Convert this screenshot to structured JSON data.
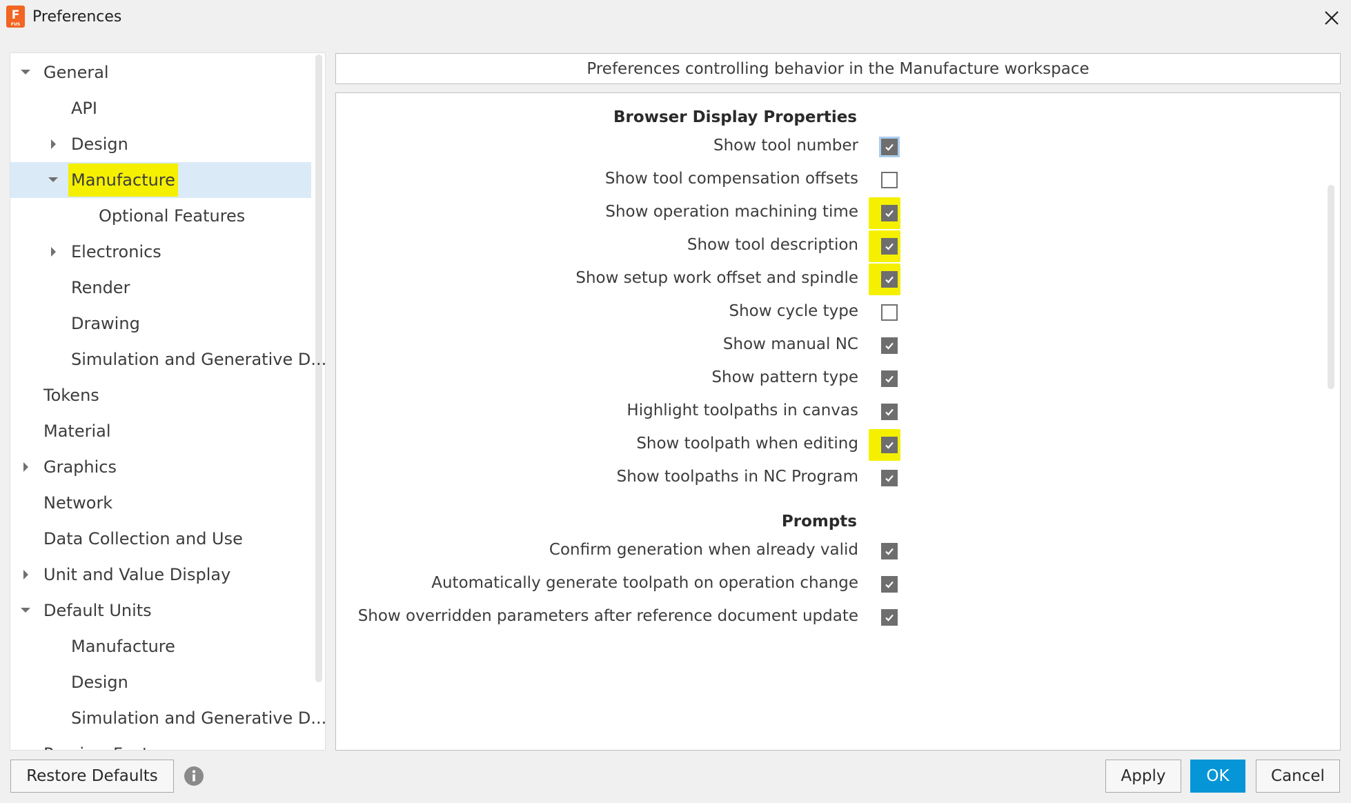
{
  "window": {
    "title": "Preferences",
    "app_icon_letter": "F",
    "app_icon_sub": "FUS"
  },
  "tree": {
    "items": [
      {
        "label": "General",
        "level": 0,
        "expander": "expanded"
      },
      {
        "label": "API",
        "level": 1,
        "expander": "none"
      },
      {
        "label": "Design",
        "level": 1,
        "expander": "collapsed"
      },
      {
        "label": "Manufacture",
        "level": 1,
        "expander": "expanded",
        "selected": true,
        "highlighted": true
      },
      {
        "label": "Optional Features",
        "level": 2,
        "expander": "none"
      },
      {
        "label": "Electronics",
        "level": 1,
        "expander": "collapsed"
      },
      {
        "label": "Render",
        "level": 1,
        "expander": "none"
      },
      {
        "label": "Drawing",
        "level": 1,
        "expander": "none"
      },
      {
        "label": "Simulation and Generative D...",
        "level": 1,
        "expander": "none"
      },
      {
        "label": "Tokens",
        "level": 0,
        "expander": "none"
      },
      {
        "label": "Material",
        "level": 0,
        "expander": "none"
      },
      {
        "label": "Graphics",
        "level": 0,
        "expander": "collapsed"
      },
      {
        "label": "Network",
        "level": 0,
        "expander": "none"
      },
      {
        "label": "Data Collection and Use",
        "level": 0,
        "expander": "none"
      },
      {
        "label": "Unit and Value Display",
        "level": 0,
        "expander": "collapsed"
      },
      {
        "label": "Default Units",
        "level": 0,
        "expander": "expanded"
      },
      {
        "label": "Manufacture",
        "level": 1,
        "expander": "none"
      },
      {
        "label": "Design",
        "level": 1,
        "expander": "none"
      },
      {
        "label": "Simulation and Generative D...",
        "level": 1,
        "expander": "none"
      },
      {
        "label": "Preview Features",
        "level": 0,
        "expander": "none"
      }
    ]
  },
  "header": {
    "text": "Preferences controlling behavior in the Manufacture workspace"
  },
  "sections": [
    {
      "heading": "Browser Display Properties",
      "options": [
        {
          "label": "Show tool number",
          "checked": true,
          "focused": true,
          "highlighted": false
        },
        {
          "label": "Show tool compensation offsets",
          "checked": false,
          "highlighted": false
        },
        {
          "label": "Show operation machining time",
          "checked": true,
          "highlighted": true
        },
        {
          "label": "Show tool description",
          "checked": true,
          "highlighted": true
        },
        {
          "label": "Show setup work offset and spindle",
          "checked": true,
          "highlighted": true
        },
        {
          "label": "Show cycle type",
          "checked": false,
          "highlighted": false
        },
        {
          "label": "Show manual NC",
          "checked": true,
          "highlighted": false
        },
        {
          "label": "Show pattern type",
          "checked": true,
          "highlighted": false
        },
        {
          "label": "Highlight toolpaths in canvas",
          "checked": true,
          "highlighted": false
        },
        {
          "label": "Show toolpath when editing",
          "checked": true,
          "highlighted": true
        },
        {
          "label": "Show toolpaths in NC Program",
          "checked": true,
          "highlighted": false
        }
      ]
    },
    {
      "heading": "Prompts",
      "options": [
        {
          "label": "Confirm generation when already valid",
          "checked": true,
          "highlighted": false
        },
        {
          "label": "Automatically generate toolpath on operation change",
          "checked": true,
          "highlighted": false
        },
        {
          "label": "Show overridden parameters after reference document update",
          "checked": true,
          "highlighted": false
        }
      ]
    }
  ],
  "buttons": {
    "restore_defaults": "Restore Defaults",
    "apply": "Apply",
    "ok": "OK",
    "cancel": "Cancel"
  },
  "colors": {
    "highlight": "#f5f000",
    "selection": "#dbeaf7",
    "primary_button": "#0696d7",
    "app_icon": "#f26522"
  },
  "icons": {
    "close": "close-icon",
    "info": "info-icon",
    "expand": "chevron-down-icon",
    "collapse": "chevron-right-icon"
  }
}
